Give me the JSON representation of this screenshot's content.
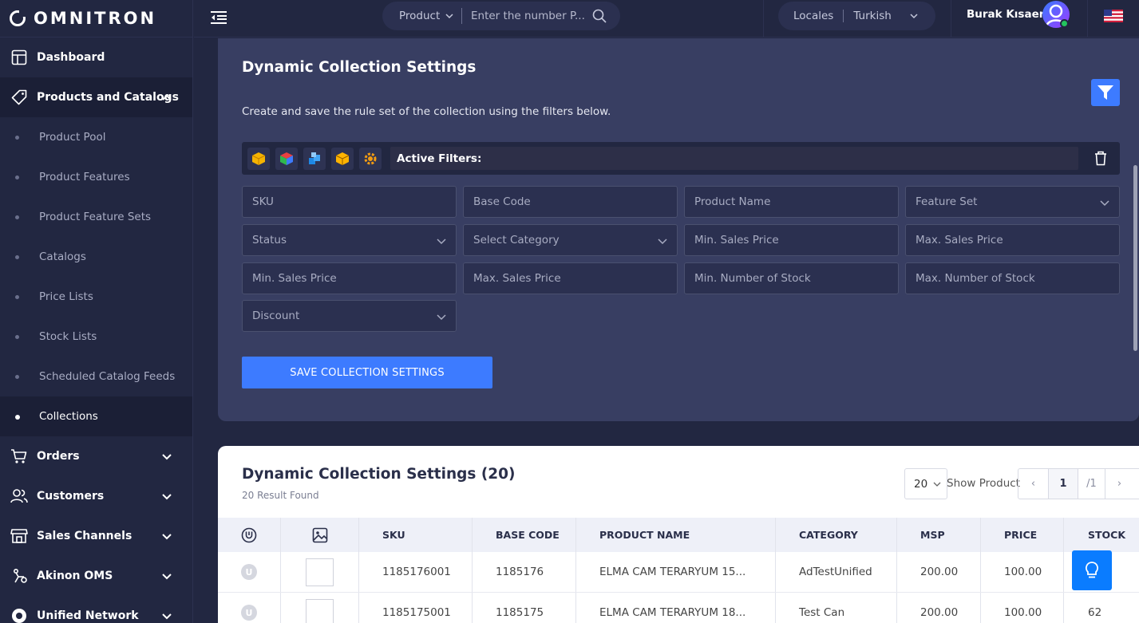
{
  "brand": {
    "name": "OMNITRON"
  },
  "sidebar": {
    "items": [
      {
        "label": "Dashboard"
      },
      {
        "label": "Products and Catalogs"
      },
      {
        "label": "Orders"
      },
      {
        "label": "Customers"
      },
      {
        "label": "Sales Channels"
      },
      {
        "label": "Akinon OMS"
      },
      {
        "label": "Unified Network"
      }
    ],
    "sub_items": [
      {
        "label": "Product Pool"
      },
      {
        "label": "Product Features"
      },
      {
        "label": "Product Feature Sets"
      },
      {
        "label": "Catalogs"
      },
      {
        "label": "Price Lists"
      },
      {
        "label": "Stock Lists"
      },
      {
        "label": "Scheduled Catalog Feeds"
      },
      {
        "label": "Collections"
      }
    ]
  },
  "header": {
    "search_type": "Product",
    "search_placeholder": "Enter the number P...",
    "locale_label": "Locales",
    "locale_value": "Turkish",
    "user_name": "Burak Kısaer"
  },
  "filter_card": {
    "title": "Dynamic Collection Settings",
    "description": "Create and save the rule set of the collection using the filters below.",
    "active_filters_label": "Active Filters:",
    "fields": {
      "sku": "SKU",
      "base_code": "Base Code",
      "product_name": "Product Name",
      "feature_set": "Feature Set",
      "status": "Status",
      "select_category": "Select Category",
      "min_sales_price_1": "Min. Sales Price",
      "max_sales_price_1": "Max. Sales Price",
      "min_sales_price_2": "Min. Sales Price",
      "max_sales_price_2": "Max. Sales Price",
      "min_stock": "Min. Number of Stock",
      "max_stock": "Max. Number of Stock",
      "discount": "Discount"
    },
    "save_label": "SAVE COLLECTION SETTINGS"
  },
  "table_card": {
    "title": "Dynamic Collection Settings (20)",
    "subtitle": "20 Result Found",
    "page_size": "20",
    "show_label": "Show Product",
    "pager": {
      "prev": "‹",
      "current": "1",
      "total": "/1",
      "next": "›"
    },
    "columns": [
      "SKU",
      "BASE CODE",
      "PRODUCT NAME",
      "CATEGORY",
      "MSP",
      "PRICE",
      "STOCK"
    ],
    "rows": [
      {
        "sku": "1185176001",
        "base_code": "1185176",
        "product_name": "ELMA CAM TERARYUM 15...",
        "category": "AdTestUnified",
        "msp": "200.00",
        "price": "100.00",
        "stock": ""
      },
      {
        "sku": "1185175001",
        "base_code": "1185175",
        "product_name": "ELMA CAM TERARYUM 18...",
        "category": "Test Can",
        "msp": "200.00",
        "price": "100.00",
        "stock": "62"
      }
    ]
  },
  "colors": {
    "accent": "#3d7bff",
    "sidebar_bg": "#222741",
    "card_bg": "#383e62"
  }
}
